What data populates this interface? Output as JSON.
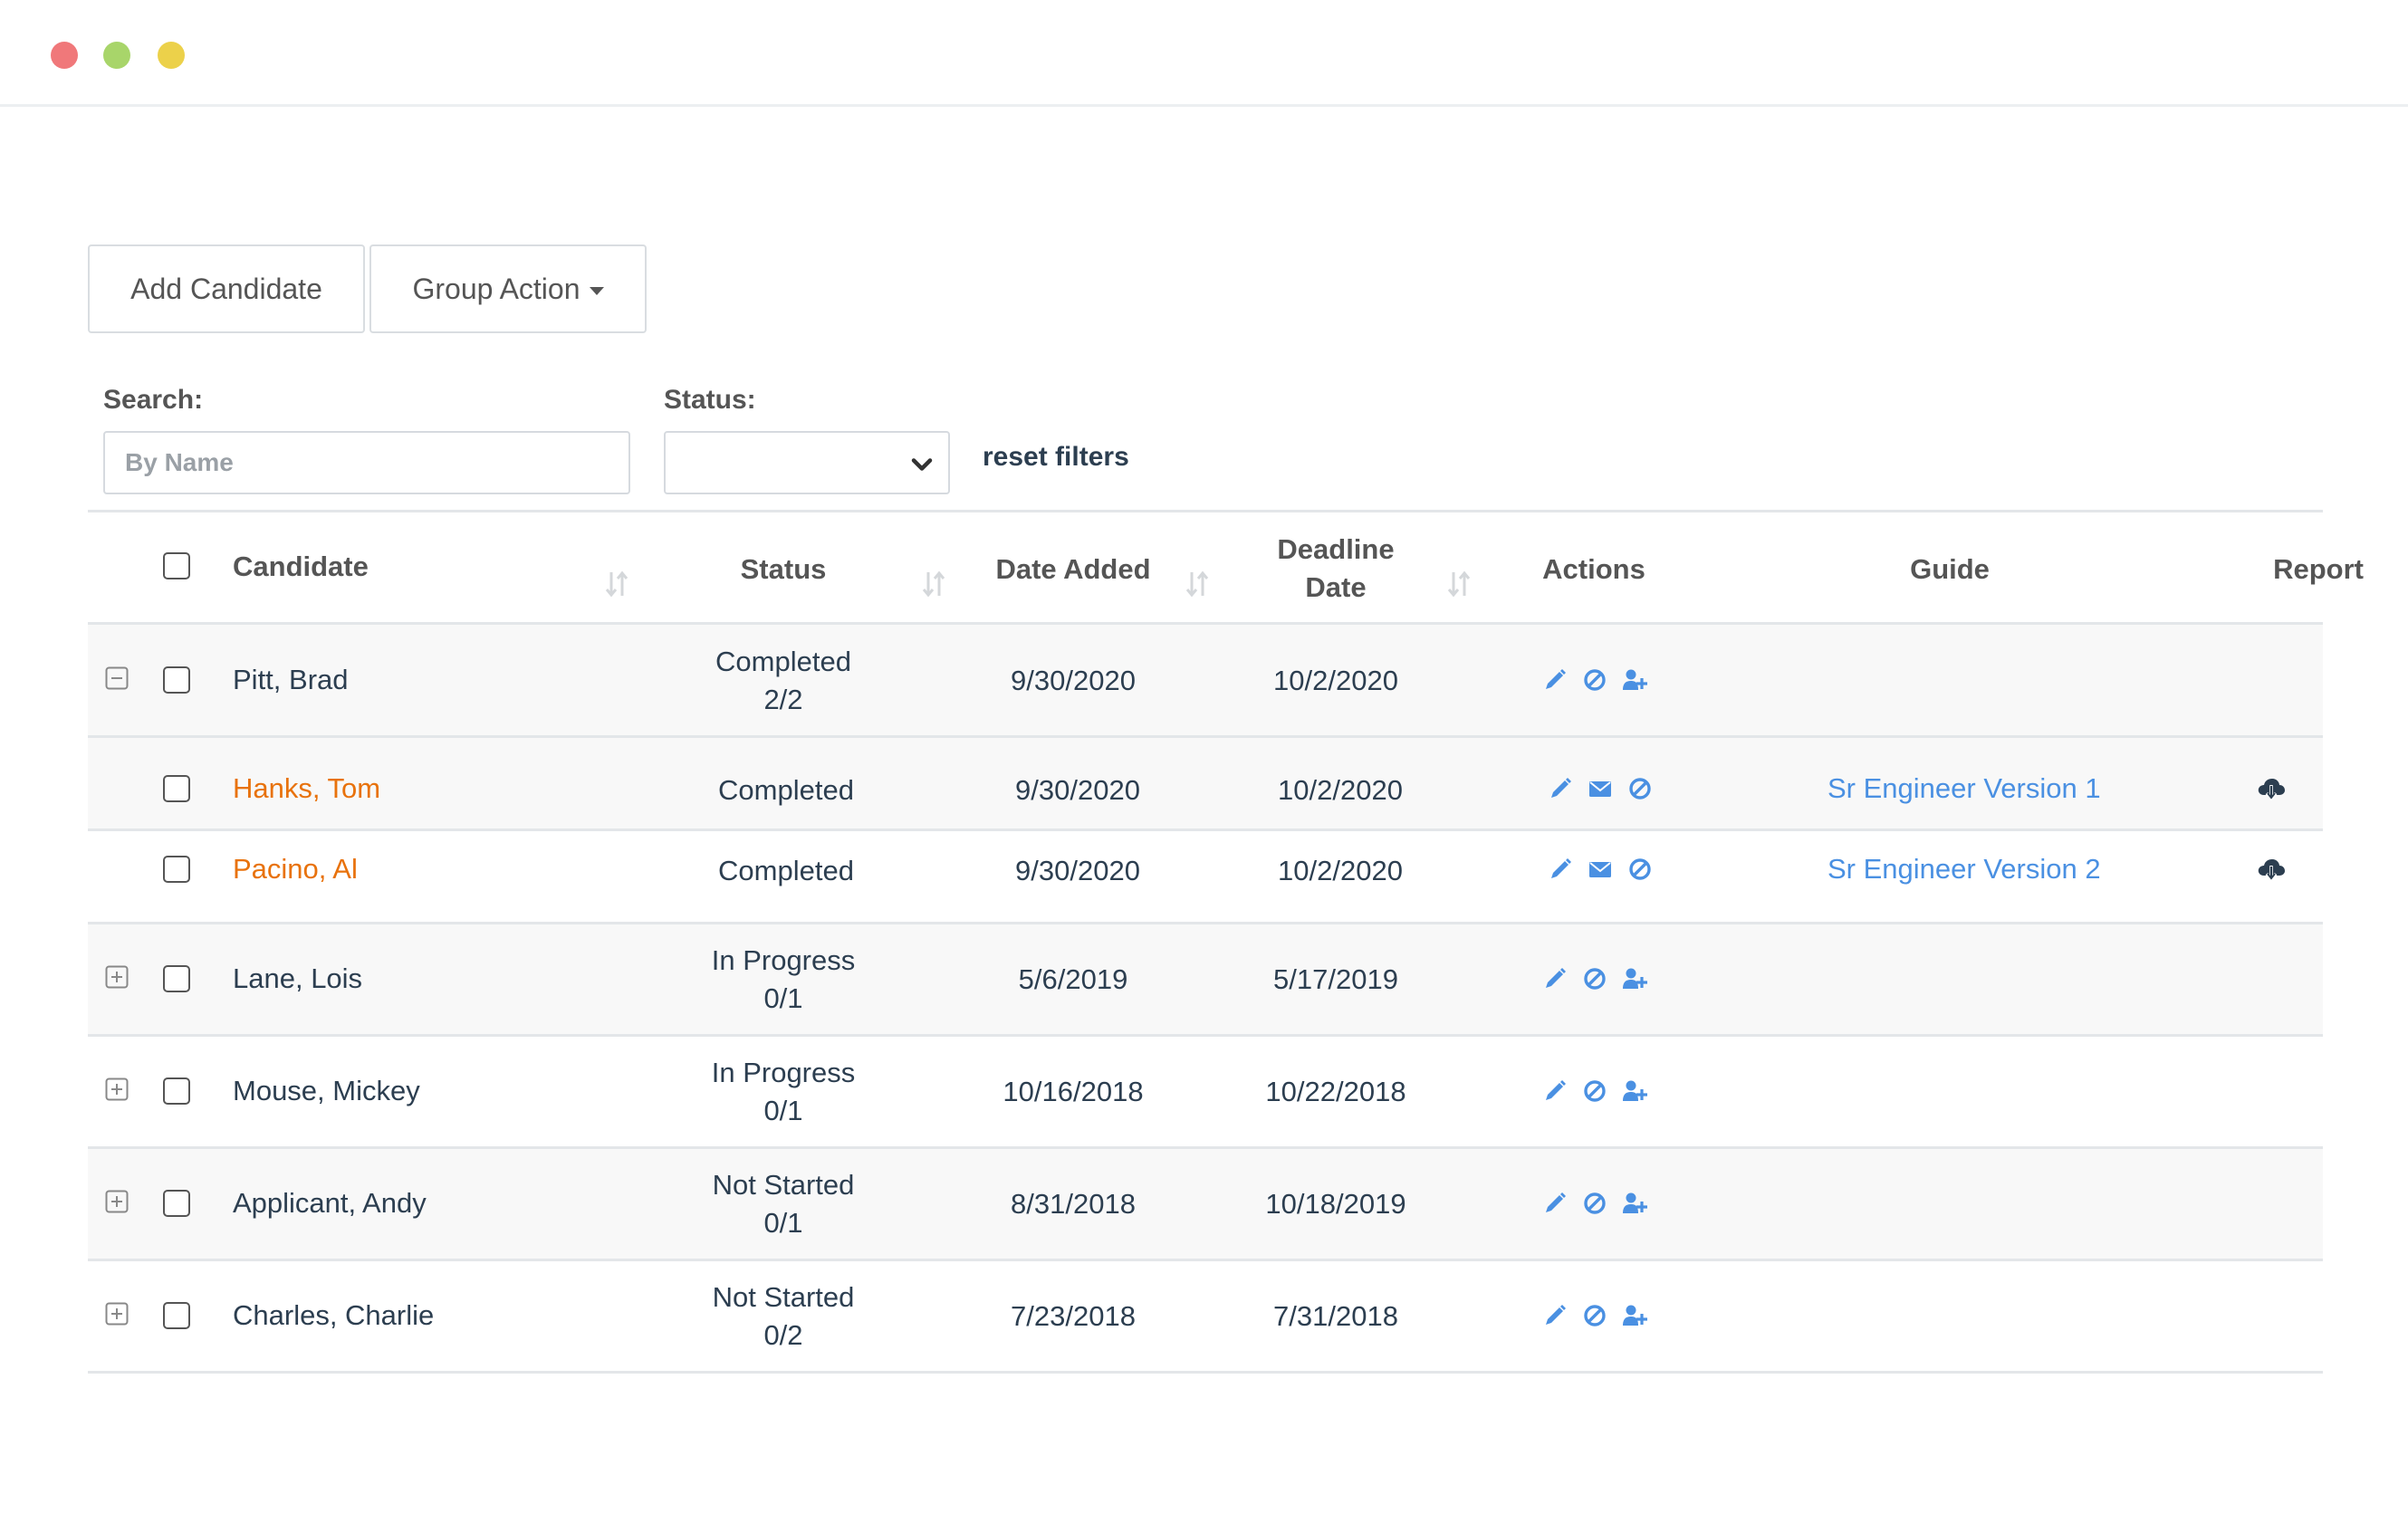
{
  "window": {
    "dots": [
      "#f0787a",
      "#a8d56a",
      "#ecd14a"
    ]
  },
  "toolbar": {
    "add_label": "Add Candidate",
    "group_label": "Group Action"
  },
  "filters": {
    "search_label": "Search:",
    "search_placeholder": "By Name",
    "status_label": "Status:",
    "status_value": "",
    "reset_label": "reset filters"
  },
  "table": {
    "headers": {
      "candidate": "Candidate",
      "status": "Status",
      "date_added": "Date Added",
      "deadline_1": "Deadline",
      "deadline_2": "Date",
      "actions": "Actions",
      "guide": "Guide",
      "report": "Report"
    },
    "rows": [
      {
        "name": "Pitt, Brad",
        "status": "Completed",
        "progress": "2/2",
        "added": "9/30/2020",
        "deadline": "10/2/2020",
        "expanded": true
      },
      {
        "name": "Hanks, Tom",
        "status": "Completed",
        "added": "9/30/2020",
        "deadline": "10/2/2020",
        "guide": "Sr Engineer Version 1",
        "child": true
      },
      {
        "name": "Pacino, Al",
        "status": "Completed",
        "added": "9/30/2020",
        "deadline": "10/2/2020",
        "guide": "Sr Engineer Version 2",
        "child": true
      },
      {
        "name": "Lane, Lois",
        "status": "In Progress",
        "progress": "0/1",
        "added": "5/6/2019",
        "deadline": "5/17/2019"
      },
      {
        "name": "Mouse, Mickey",
        "status": "In Progress",
        "progress": "0/1",
        "added": "10/16/2018",
        "deadline": "10/22/2018"
      },
      {
        "name": "Applicant, Andy",
        "status": "Not Started",
        "progress": "0/1",
        "added": "8/31/2018",
        "deadline": "10/18/2019"
      },
      {
        "name": "Charles, Charlie",
        "status": "Not Started",
        "progress": "0/2",
        "added": "7/23/2018",
        "deadline": "7/31/2018"
      }
    ]
  },
  "icons": {
    "edit": "pencil-icon",
    "cancel": "ban-icon",
    "email": "envelope-icon",
    "add_user": "user-plus-icon",
    "report": "cloud-download-icon",
    "expand": "plus-square-icon",
    "collapse": "minus-square-icon"
  },
  "colors": {
    "link": "#4a90e2",
    "child_name": "#e8720c",
    "icon_blue": "#4a90e2"
  }
}
